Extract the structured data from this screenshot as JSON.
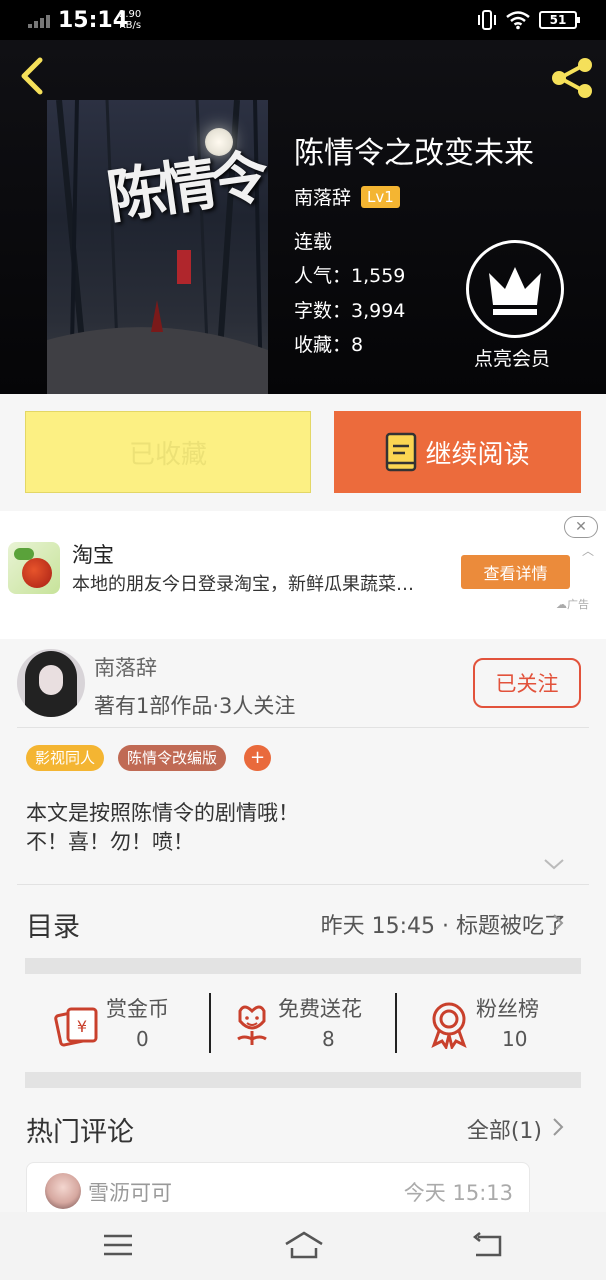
{
  "status_bar": {
    "time": "15:14",
    "speed_value": "2.90",
    "speed_unit": "KB/s",
    "battery": "51"
  },
  "book": {
    "title": "陈情令之改变未来",
    "cover_text": "陈情令",
    "author": "南落辞",
    "level": "Lv1",
    "status": "连载",
    "popularity": "人气：1,559",
    "word_count": "字数：3,994",
    "favorites": "收藏：8"
  },
  "vip": {
    "label": "点亮会员"
  },
  "actions": {
    "collected_label": "已收藏",
    "read_label": "继续阅读"
  },
  "ad": {
    "title": "淘宝",
    "description": "本地的朋友今日登录淘宝，新鲜瓜果蔬菜…",
    "button": "查看详情",
    "tag": "广告"
  },
  "author": {
    "name": "南落辞",
    "stats": "著有1部作品·3人关注",
    "follow_label": "已关注"
  },
  "tags": [
    {
      "label": "影视同人",
      "color": "#f4b532"
    },
    {
      "label": "陈情令改编版",
      "color": "#c06a54"
    }
  ],
  "tag_add": "+",
  "description": [
    "本文是按照陈情令的剧情哦！",
    "不！喜！勿！喷！"
  ],
  "toc": {
    "title": "目录",
    "latest": "昨天 15:45 · 标题被吃了"
  },
  "stats": [
    {
      "label": "赏金币",
      "value": "0",
      "icon": "reward-coin-icon"
    },
    {
      "label": "免费送花",
      "value": "8",
      "icon": "flower-icon"
    },
    {
      "label": "粉丝榜",
      "value": "10",
      "icon": "medal-icon"
    }
  ],
  "hot_comments": {
    "title": "热门评论",
    "all_label": "全部(1)",
    "items": [
      {
        "user": "雪沥可可",
        "time": "今天 15:13"
      }
    ]
  },
  "colors": {
    "accent": "#ec6b3c",
    "collected_bg": "#fcf083",
    "level_badge": "#f4b532",
    "follow_red": "#e2523b",
    "stat_icon_red": "#c9402c"
  }
}
